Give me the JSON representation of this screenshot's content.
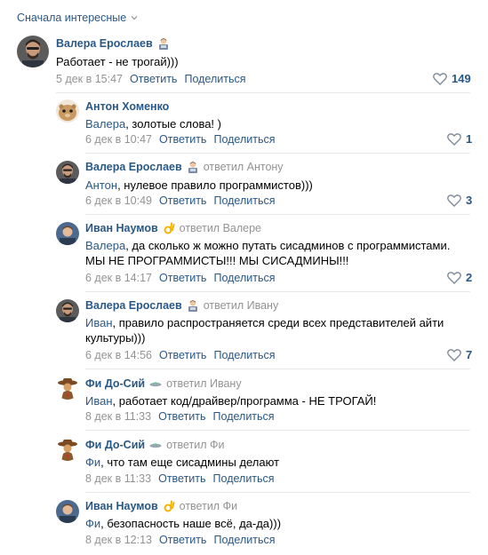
{
  "sort": {
    "label": "Сначала интересные"
  },
  "actions": {
    "reply": "Ответить",
    "share": "Поделиться"
  },
  "comments": [
    {
      "author": "Валера Ерослаев",
      "replied": "",
      "mention": "",
      "text": "Работает - не трогай)))",
      "text2": "",
      "date": "5 дек в 15:47",
      "likes": "149"
    },
    {
      "author": "Антон Хоменко",
      "replied": "",
      "mention": "Валера",
      "text": ", золотые слова! )",
      "text2": "",
      "date": "6 дек в 10:47",
      "likes": "1"
    },
    {
      "author": "Валера Ерослаев",
      "replied": "ответил Антону",
      "mention": "Антон",
      "text": ", нулевое правило программистов)))",
      "text2": "",
      "date": "6 дек в 10:49",
      "likes": "3"
    },
    {
      "author": "Иван Наумов",
      "replied": "ответил Валере",
      "mention": "Валера",
      "text": ", да сколько ж можно путать сисадминов с программистами.",
      "text2": "МЫ НЕ ПРОГРАММИСТЫ!!! МЫ СИСАДМИНЫ!!!",
      "date": "6 дек в 14:17",
      "likes": "2"
    },
    {
      "author": "Валера Ерослаев",
      "replied": "ответил Ивану",
      "mention": "Иван",
      "text": ", правило распространяется среди всех представителей айти",
      "text2": "культуры)))",
      "date": "6 дек в 14:56",
      "likes": "7"
    },
    {
      "author": "Фи До-Сий",
      "replied": "ответил Ивану",
      "mention": "Иван",
      "text": ", работает код/драйвер/программа - НЕ ТРОГАЙ!",
      "text2": "",
      "date": "8 дек в 11:33",
      "likes": ""
    },
    {
      "author": "Фи До-Сий",
      "replied": "ответил Фи",
      "mention": "Фи",
      "text": ", что там еще сисадмины делают",
      "text2": "",
      "date": "8 дек в 11:33",
      "likes": ""
    },
    {
      "author": "Иван Наумов",
      "replied": "ответил Фи",
      "mention": "Фи",
      "text": ", безопасность наше всё, да-да)))",
      "text2": "",
      "date": "8 дек в 12:13",
      "likes": ""
    }
  ],
  "colors": {
    "link": "#2a5885",
    "muted": "#939393",
    "divider": "#e7e8ec"
  }
}
